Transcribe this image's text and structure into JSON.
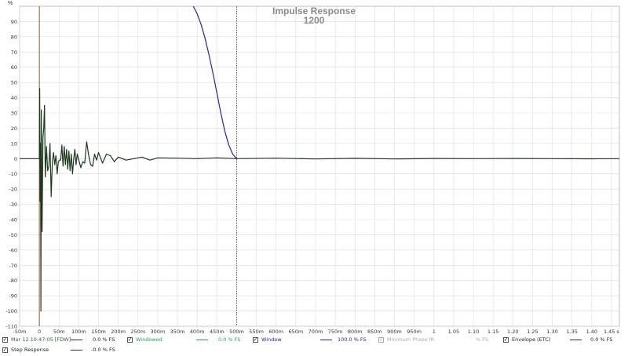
{
  "chart_data": {
    "type": "line",
    "title": "Impulse Response",
    "subtitle": "1200",
    "ylabel": "%",
    "xlabel": "",
    "xlim": [
      -0.05,
      1.47
    ],
    "ylim": [
      -110,
      100
    ],
    "grid": true,
    "y_ticks": [
      "90",
      "80",
      "70",
      "60",
      "50",
      "40",
      "30",
      "20",
      "10",
      "0",
      "-10",
      "-20",
      "-30",
      "-40",
      "-50",
      "-60",
      "-70",
      "-80",
      "-90",
      "-100",
      "-110"
    ],
    "x_tick_values": [
      -0.05,
      0,
      0.05,
      0.1,
      0.15,
      0.2,
      0.25,
      0.3,
      0.35,
      0.4,
      0.45,
      0.5,
      0.55,
      0.6,
      0.65,
      0.7,
      0.75,
      0.8,
      0.85,
      0.9,
      0.95,
      1.0,
      1.05,
      1.1,
      1.15,
      1.2,
      1.25,
      1.3,
      1.35,
      1.4,
      1.45
    ],
    "x_tick_labels": [
      "-50m",
      "0",
      "50m",
      "100m",
      "150m",
      "200m",
      "250m",
      "300m",
      "350m",
      "400m",
      "450m",
      "500m",
      "550m",
      "600m",
      "650m",
      "700m",
      "750m",
      "800m",
      "850m",
      "900m",
      "950m",
      "1",
      "1.05",
      "1.10",
      "1.15",
      "1.20",
      "1.25",
      "1.30",
      "1.35",
      "1.40",
      "1.45 s"
    ],
    "marker_x": 0.0,
    "window_end_x": 0.5,
    "series": [
      {
        "name": "Mar 12 10:47:05 [FDW]",
        "color": "#1e3a1e",
        "x": [
          -0.05,
          0.0,
          0.001,
          0.002,
          0.003,
          0.004,
          0.005,
          0.007,
          0.009,
          0.011,
          0.013,
          0.015,
          0.018,
          0.021,
          0.024,
          0.027,
          0.03,
          0.033,
          0.036,
          0.039,
          0.042,
          0.045,
          0.048,
          0.051,
          0.054,
          0.057,
          0.06,
          0.063,
          0.066,
          0.069,
          0.072,
          0.075,
          0.078,
          0.081,
          0.084,
          0.087,
          0.09,
          0.093,
          0.096,
          0.1,
          0.105,
          0.11,
          0.115,
          0.12,
          0.125,
          0.13,
          0.135,
          0.14,
          0.145,
          0.15,
          0.16,
          0.17,
          0.18,
          0.19,
          0.2,
          0.22,
          0.24,
          0.26,
          0.28,
          0.3,
          0.35,
          0.4,
          0.45,
          0.5,
          0.6,
          0.7,
          0.8,
          0.9,
          1.0,
          1.1,
          1.2,
          1.3,
          1.4,
          1.47
        ],
        "y": [
          0,
          0,
          46,
          -28,
          10,
          -100,
          32,
          -48,
          14,
          20,
          35,
          -12,
          8,
          -8,
          -5,
          10,
          -25,
          -2,
          4,
          -4,
          2,
          -10,
          -2,
          -1,
          -1,
          9,
          -5,
          8,
          -4,
          6,
          -7,
          5,
          -8,
          3,
          -10,
          0,
          6,
          -4,
          3,
          -1,
          -6,
          -2,
          -3,
          11,
          2,
          -4,
          -5,
          3,
          -1,
          4,
          -3,
          3,
          2,
          -2,
          1,
          -1,
          0,
          1,
          -1,
          0.5,
          0.3,
          0,
          0.5,
          0,
          0.3,
          -0.2,
          0.2,
          -0.2,
          0.1,
          0,
          0.1,
          0,
          -0.1,
          0
        ]
      },
      {
        "name": "Window",
        "color": "#2222bb",
        "x": [
          0.39,
          0.4,
          0.41,
          0.42,
          0.43,
          0.44,
          0.45,
          0.46,
          0.47,
          0.48,
          0.49,
          0.5
        ],
        "y": [
          100,
          95,
          88,
          79,
          68,
          56,
          43,
          30,
          18,
          9,
          3,
          0
        ]
      }
    ]
  },
  "legend": {
    "items": [
      {
        "label": "Mar 12 10:47:05 [FDW]",
        "value": "0.0 % FS",
        "color": "#1e3a1e",
        "label_color": "#2a6a2a",
        "checked": "✓"
      },
      {
        "label": "Windowed",
        "value": "0.0 % FS",
        "color": "#22a050",
        "label_color": "#22a050",
        "checked": "✓"
      },
      {
        "label": "Window",
        "value": "100.0 % FS",
        "color": "#2222bb",
        "label_color": "#2222bb",
        "checked": "✓"
      },
      {
        "label": "Minimum Phase IR",
        "value": "% FS",
        "color": "#bbbbbb",
        "label_color": "#aaaaaa",
        "checked": "✓"
      },
      {
        "label": "Envelope (ETC)",
        "value": "0.0 % FS",
        "color": "#1e3a1e",
        "label_color": "#333333",
        "checked": "✓"
      },
      {
        "label": "Step Response",
        "value": "-0.0 % FS",
        "color": "#1e3a1e",
        "label_color": "#333333",
        "checked": "✓"
      }
    ]
  }
}
